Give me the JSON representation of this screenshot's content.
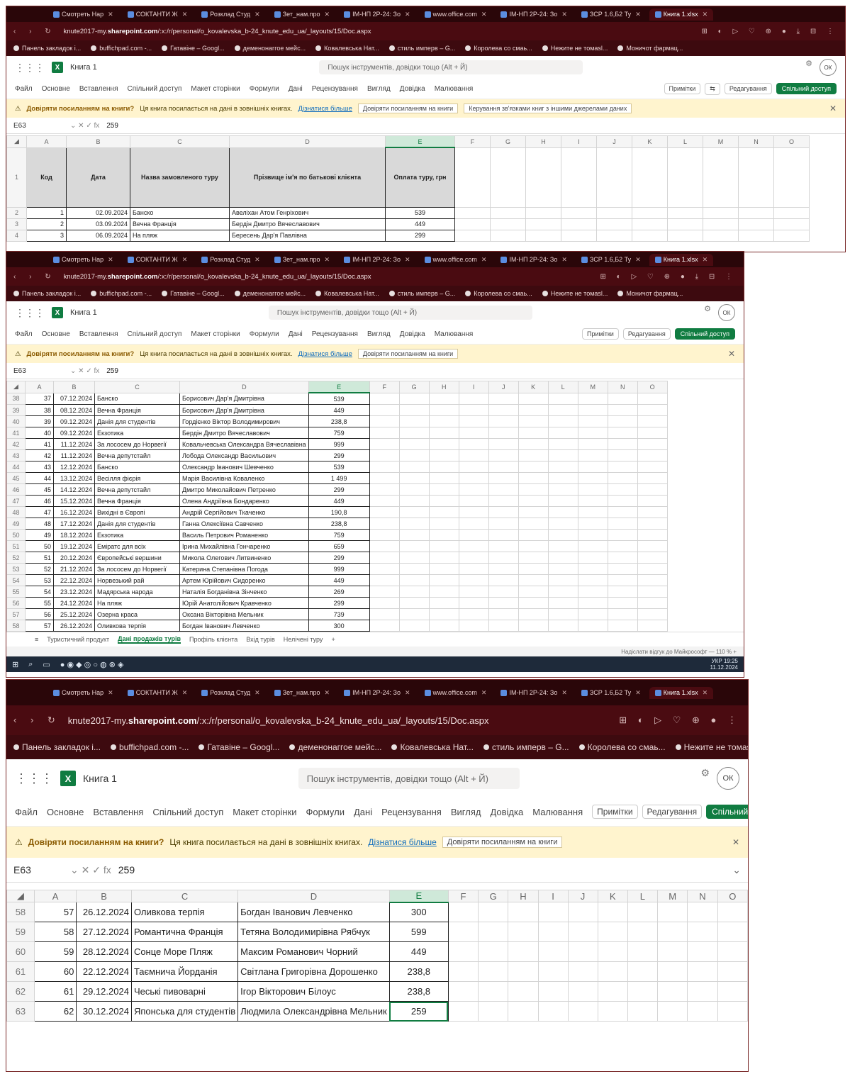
{
  "browser": {
    "tabs": [
      {
        "label": "Смотреть Нар"
      },
      {
        "label": "СОКТАНТИ Ж"
      },
      {
        "label": "Розклад Студ"
      },
      {
        "label": "Зет_нам.про"
      },
      {
        "label": "ІМ-НП 2Р-24: Зо"
      },
      {
        "label": "www.office.com"
      },
      {
        "label": "ІМ-НП 2Р-24: Зо"
      },
      {
        "label": "ЗСР 1.6,Б2 Ту"
      },
      {
        "label": "Книга 1.xlsx"
      }
    ],
    "url_prefix": "knute2017-my.",
    "url_domain": "sharepoint.com",
    "url_rest": "/:x:/r/personal/o_kovalevska_b-24_knute_edu_ua/_layouts/15/Doc.aspx",
    "bookmarks": [
      "Панель закладок і...",
      "buffichpad.com -...",
      "Гатавіне – Googl...",
      "деменонаггое мейс...",
      "Ковалевська Нат...",
      "стиль имперв – G...",
      "Королева со смаь...",
      "Нежите не томаsl...",
      "Моничот фармац..."
    ]
  },
  "excel": {
    "book_name": "Книга 1",
    "search_placeholder": "Пошук інструментів, довідки тощо (Alt + Й)",
    "avatar": "ОК",
    "ribbon_tabs": [
      "Файл",
      "Основне",
      "Вставлення",
      "Спільний доступ",
      "Макет сторінки",
      "Формули",
      "Дані",
      "Рецензування",
      "Вигляд",
      "Довідка",
      "Малювання"
    ],
    "btn_notes": "Примітки",
    "btn_edit": "Редагування",
    "btn_share": "Спільний доступ",
    "warning_title": "Довіряти посиланням на книги?",
    "warning_text": "Ця книга посилається на дані в зовнішніх книгах.",
    "warning_link": "Дізнатися більше",
    "warning_btn1": "Довіряти посиланням на книги",
    "warning_btn2": "Керування зв'язками книг з іншими джерелами даних",
    "name_box": "E63",
    "formula_value": "259",
    "sheet_tabs": [
      "Туристичний продукт",
      "Дані продажів турів",
      "Профіль клієнта",
      "Вхід турів",
      "Нелічені туру"
    ],
    "status_right": "Надіслати відгук до Майкрософт    —    110 %   +"
  },
  "grid_columns": [
    "A",
    "B",
    "C",
    "D",
    "E",
    "F",
    "G",
    "H",
    "I",
    "J",
    "K",
    "L",
    "M",
    "N",
    "O"
  ],
  "header_row": {
    "row": "1",
    "code": "Код",
    "date": "Дата",
    "tour": "Назва замовленого туру",
    "client": "Прізвище ім'я по батькові клієнта",
    "pay": "Оплата туру, грн"
  },
  "top_rows": [
    {
      "r": "2",
      "a": "1",
      "b": "02.09.2024",
      "c": "Банско",
      "d": "Авеліхан Атом Генріхович",
      "e": "539"
    },
    {
      "r": "3",
      "a": "2",
      "b": "03.09.2024",
      "c": "Вечна Франція",
      "d": "Бердін Дмитро Вячеславович",
      "e": "449"
    },
    {
      "r": "4",
      "a": "3",
      "b": "06.09.2024",
      "c": "На пляж",
      "d": "Бересень Дар'я Павлівна",
      "e": "299"
    }
  ],
  "mid_rows": [
    {
      "r": "38",
      "a": "37",
      "b": "07.12.2024",
      "c": "Банско",
      "d": "Борисович Дар'я Дмитрівна",
      "e": "539"
    },
    {
      "r": "39",
      "a": "38",
      "b": "08.12.2024",
      "c": "Вечна Франція",
      "d": "Борисович Дар'я Дмитрівна",
      "e": "449"
    },
    {
      "r": "40",
      "a": "39",
      "b": "09.12.2024",
      "c": "Данія для студентів",
      "d": "Гордієнко Віктор Володимирович",
      "e": "238,8"
    },
    {
      "r": "41",
      "a": "40",
      "b": "09.12.2024",
      "c": "Екзотика",
      "d": "Бердін Дмитро Вячеславович",
      "e": "759"
    },
    {
      "r": "42",
      "a": "41",
      "b": "11.12.2024",
      "c": "За лососем до Норвегії",
      "d": "Ковальчевська Олександра Вячеславівна",
      "e": "999"
    },
    {
      "r": "43",
      "a": "42",
      "b": "11.12.2024",
      "c": "Вечна депутстайл",
      "d": "Лобода Олександр Васильович",
      "e": "299"
    },
    {
      "r": "44",
      "a": "43",
      "b": "12.12.2024",
      "c": "Банско",
      "d": "Олександр Іванович Шевченко",
      "e": "539"
    },
    {
      "r": "45",
      "a": "44",
      "b": "13.12.2024",
      "c": "Весілля фієрія",
      "d": "Марія Василівна Коваленко",
      "e": "1 499"
    },
    {
      "r": "46",
      "a": "45",
      "b": "14.12.2024",
      "c": "Вечна депутстайл",
      "d": "Дмитро Миколайович Петренко",
      "e": "299"
    },
    {
      "r": "47",
      "a": "46",
      "b": "15.12.2024",
      "c": "Вечна Франція",
      "d": "Олена Андріївна Бондаренко",
      "e": "449"
    },
    {
      "r": "48",
      "a": "47",
      "b": "16.12.2024",
      "c": "Вихідні в Європі",
      "d": "Андрій Сергійович Ткаченко",
      "e": "190,8"
    },
    {
      "r": "49",
      "a": "48",
      "b": "17.12.2024",
      "c": "Данія для студентів",
      "d": "Ганна Олексіївна Савченко",
      "e": "238,8"
    },
    {
      "r": "50",
      "a": "49",
      "b": "18.12.2024",
      "c": "Екзотика",
      "d": "Василь Петрович Романенко",
      "e": "759"
    },
    {
      "r": "51",
      "a": "50",
      "b": "19.12.2024",
      "c": "Еміратс для всіх",
      "d": "Ірина Михайлівна Гончаренко",
      "e": "659"
    },
    {
      "r": "52",
      "a": "51",
      "b": "20.12.2024",
      "c": "Європейські вершини",
      "d": "Микола Олегович Литвиненко",
      "e": "299"
    },
    {
      "r": "53",
      "a": "52",
      "b": "21.12.2024",
      "c": "За лососем до Норвегії",
      "d": "Катерина Степанівна Погода",
      "e": "999"
    },
    {
      "r": "54",
      "a": "53",
      "b": "22.12.2024",
      "c": "Норвезький рай",
      "d": "Артем Юрійович Сидоренко",
      "e": "449"
    },
    {
      "r": "55",
      "a": "54",
      "b": "23.12.2024",
      "c": "Мадярська народа",
      "d": "Наталія Богданівна Зінченко",
      "e": "269"
    },
    {
      "r": "56",
      "a": "55",
      "b": "24.12.2024",
      "c": "На пляж",
      "d": "Юрій Анатолійович Кравченко",
      "e": "299"
    },
    {
      "r": "57",
      "a": "56",
      "b": "25.12.2024",
      "c": "Озерна краса",
      "d": "Оксана Вікторівна Мельник",
      "e": "739"
    },
    {
      "r": "58",
      "a": "57",
      "b": "26.12.2024",
      "c": "Оливкова терпія",
      "d": "Богдан Іванович Левченко",
      "e": "300"
    }
  ],
  "bottom_rows": [
    {
      "r": "58",
      "a": "57",
      "b": "26.12.2024",
      "c": "Оливкова терпія",
      "d": "Богдан Іванович Левченко",
      "e": "300"
    },
    {
      "r": "59",
      "a": "58",
      "b": "27.12.2024",
      "c": "Романтична Франція",
      "d": "Тетяна Володимирівна Рябчук",
      "e": "599"
    },
    {
      "r": "60",
      "a": "59",
      "b": "28.12.2024",
      "c": "Сонце Море Пляж",
      "d": "Максим Романович Чорний",
      "e": "449"
    },
    {
      "r": "61",
      "a": "60",
      "b": "22.12.2024",
      "c": "Таємнича Йорданія",
      "d": "Світлана Григорівна Дорошенко",
      "e": "238,8"
    },
    {
      "r": "62",
      "a": "61",
      "b": "29.12.2024",
      "c": "Чеські пивоварні",
      "d": "Ігор Вікторович Білоус",
      "e": "238,8"
    },
    {
      "r": "63",
      "a": "62",
      "b": "30.12.2024",
      "c": "Японська для студентів",
      "d": "Людмила Олександрівна Мельник",
      "e": "259"
    }
  ],
  "taskbar": {
    "time": "19:25",
    "date": "11.12.2024",
    "lang": "УКР"
  }
}
